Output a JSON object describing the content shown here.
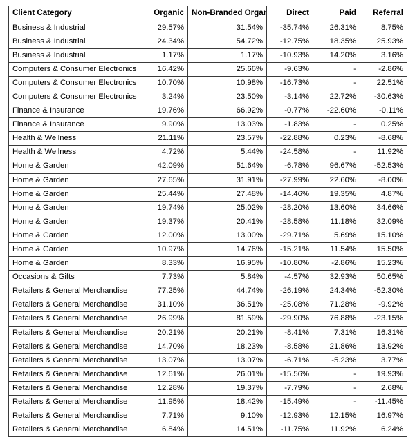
{
  "table": {
    "name": "client-category-channel-change-table",
    "colors": {
      "positive_fill": "#b6d7a0",
      "negative_fill": "#ef6f4e",
      "neutral_fill": "#ffffff",
      "border": "#3a3a3a",
      "text": "#000000"
    },
    "columns": [
      {
        "key": "category",
        "label": "Client Category",
        "align": "left"
      },
      {
        "key": "organic",
        "label": "Organic",
        "align": "right"
      },
      {
        "key": "non_branded_organic",
        "label": "Non-Branded Organic",
        "align": "right"
      },
      {
        "key": "direct",
        "label": "Direct",
        "align": "right"
      },
      {
        "key": "paid",
        "label": "Paid",
        "align": "right"
      },
      {
        "key": "referral",
        "label": "Referral",
        "align": "right"
      }
    ],
    "rows": [
      {
        "category": "Business & Industrial",
        "organic": "29.57%",
        "non_branded_organic": "31.54%",
        "direct": "-35.74%",
        "paid": "26.31%",
        "referral": "8.75%"
      },
      {
        "category": "Business & Industrial",
        "organic": "24.34%",
        "non_branded_organic": "54.72%",
        "direct": "-12.75%",
        "paid": "18.35%",
        "referral": "25.93%"
      },
      {
        "category": "Business & Industrial",
        "organic": "1.17%",
        "non_branded_organic": "1.17%",
        "direct": "-10.93%",
        "paid": "14.20%",
        "referral": "3.16%"
      },
      {
        "category": "Computers & Consumer Electronics",
        "organic": "16.42%",
        "non_branded_organic": "25.66%",
        "direct": "-9.63%",
        "paid": "-",
        "referral": "-2.86%"
      },
      {
        "category": "Computers & Consumer Electronics",
        "organic": "10.70%",
        "non_branded_organic": "10.98%",
        "direct": "-16.73%",
        "paid": "-",
        "referral": "22.51%"
      },
      {
        "category": "Computers & Consumer Electronics",
        "organic": "3.24%",
        "non_branded_organic": "23.50%",
        "direct": "-3.14%",
        "paid": "22.72%",
        "referral": "-30.63%"
      },
      {
        "category": "Finance & Insurance",
        "organic": "19.76%",
        "non_branded_organic": "66.92%",
        "direct": "-0.77%",
        "paid": "-22.60%",
        "referral": "-0.11%"
      },
      {
        "category": "Finance & Insurance",
        "organic": "9.90%",
        "non_branded_organic": "13.03%",
        "direct": "-1.83%",
        "paid": "-",
        "referral": "0.25%"
      },
      {
        "category": "Health & Wellness",
        "organic": "21.11%",
        "non_branded_organic": "23.57%",
        "direct": "-22.88%",
        "paid": "0.23%",
        "referral": "-8.68%"
      },
      {
        "category": "Health & Wellness",
        "organic": "4.72%",
        "non_branded_organic": "5.44%",
        "direct": "-24.58%",
        "paid": "-",
        "referral": "11.92%"
      },
      {
        "category": "Home & Garden",
        "organic": "42.09%",
        "non_branded_organic": "51.64%",
        "direct": "-6.78%",
        "paid": "96.67%",
        "referral": "-52.53%"
      },
      {
        "category": "Home & Garden",
        "organic": "27.65%",
        "non_branded_organic": "31.91%",
        "direct": "-27.99%",
        "paid": "22.60%",
        "referral": "-8.00%"
      },
      {
        "category": "Home & Garden",
        "organic": "25.44%",
        "non_branded_organic": "27.48%",
        "direct": "-14.46%",
        "paid": "19.35%",
        "referral": "4.87%"
      },
      {
        "category": "Home & Garden",
        "organic": "19.74%",
        "non_branded_organic": "25.02%",
        "direct": "-28.20%",
        "paid": "13.60%",
        "referral": "34.66%"
      },
      {
        "category": "Home & Garden",
        "organic": "19.37%",
        "non_branded_organic": "20.41%",
        "direct": "-28.58%",
        "paid": "11.18%",
        "referral": "32.09%"
      },
      {
        "category": "Home & Garden",
        "organic": "12.00%",
        "non_branded_organic": "13.00%",
        "direct": "-29.71%",
        "paid": "5.69%",
        "referral": "15.10%"
      },
      {
        "category": "Home & Garden",
        "organic": "10.97%",
        "non_branded_organic": "14.76%",
        "direct": "-15.21%",
        "paid": "11.54%",
        "referral": "15.50%"
      },
      {
        "category": "Home & Garden",
        "organic": "8.33%",
        "non_branded_organic": "16.95%",
        "direct": "-10.80%",
        "paid": "-2.86%",
        "referral": "15.23%"
      },
      {
        "category": "Occasions & Gifts",
        "organic": "7.73%",
        "non_branded_organic": "5.84%",
        "direct": "-4.57%",
        "paid": "32.93%",
        "referral": "50.65%"
      },
      {
        "category": "Retailers & General Merchandise",
        "organic": "77.25%",
        "non_branded_organic": "44.74%",
        "direct": "-26.19%",
        "paid": "24.34%",
        "referral": "-52.30%"
      },
      {
        "category": "Retailers & General Merchandise",
        "organic": "31.10%",
        "non_branded_organic": "36.51%",
        "direct": "-25.08%",
        "paid": "71.28%",
        "referral": "-9.92%"
      },
      {
        "category": "Retailers & General Merchandise",
        "organic": "26.99%",
        "non_branded_organic": "81.59%",
        "direct": "-29.90%",
        "paid": "76.88%",
        "referral": "-23.15%"
      },
      {
        "category": "Retailers & General Merchandise",
        "organic": "20.21%",
        "non_branded_organic": "20.21%",
        "direct": "-8.41%",
        "paid": "7.31%",
        "referral": "16.31%"
      },
      {
        "category": "Retailers & General Merchandise",
        "organic": "14.70%",
        "non_branded_organic": "18.23%",
        "direct": "-8.58%",
        "paid": "21.86%",
        "referral": "13.92%"
      },
      {
        "category": "Retailers & General Merchandise",
        "organic": "13.07%",
        "non_branded_organic": "13.07%",
        "direct": "-6.71%",
        "paid": "-5.23%",
        "referral": "3.77%"
      },
      {
        "category": "Retailers & General Merchandise",
        "organic": "12.61%",
        "non_branded_organic": "26.01%",
        "direct": "-15.56%",
        "paid": "-",
        "referral": "19.93%"
      },
      {
        "category": "Retailers & General Merchandise",
        "organic": "12.28%",
        "non_branded_organic": "19.37%",
        "direct": "-7.79%",
        "paid": "-",
        "referral": "2.68%"
      },
      {
        "category": "Retailers & General Merchandise",
        "organic": "11.95%",
        "non_branded_organic": "18.42%",
        "direct": "-15.49%",
        "paid": "-",
        "referral": "-11.45%"
      },
      {
        "category": "Retailers & General Merchandise",
        "organic": "7.71%",
        "non_branded_organic": "9.10%",
        "direct": "-12.93%",
        "paid": "12.15%",
        "referral": "16.97%"
      },
      {
        "category": "Retailers & General Merchandise",
        "organic": "6.84%",
        "non_branded_organic": "14.51%",
        "direct": "-11.75%",
        "paid": "11.92%",
        "referral": "6.24%"
      }
    ]
  }
}
